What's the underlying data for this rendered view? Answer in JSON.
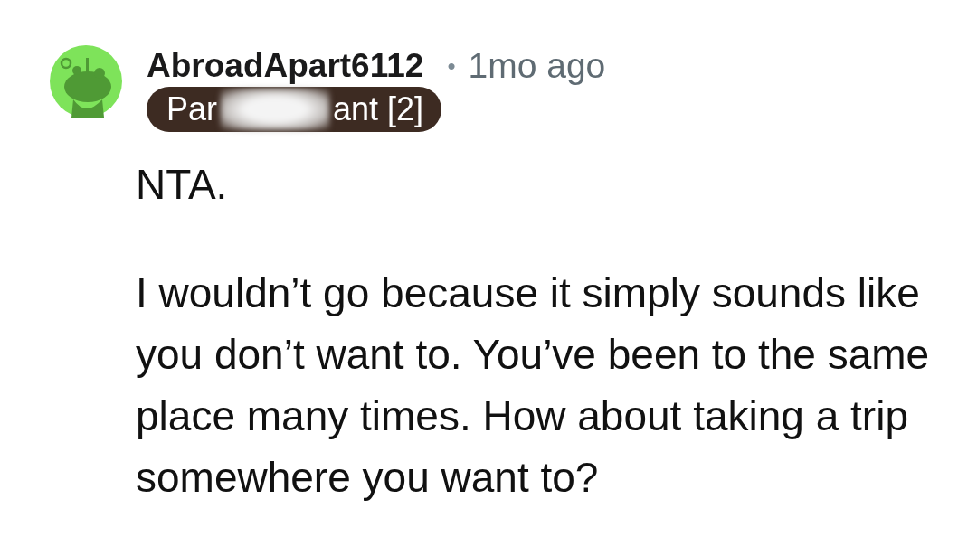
{
  "comment": {
    "author": "AbroadApart6112",
    "separator": "•",
    "age": "1mo ago",
    "flair": {
      "before": "Par",
      "after": "ant [2]",
      "redacted": true
    },
    "paragraphs": [
      "NTA.",
      "I wouldn’t go because it simply sounds like you don’t want to. You’ve been to the same place many times. How about taking a trip somewhere you want to?"
    ]
  }
}
